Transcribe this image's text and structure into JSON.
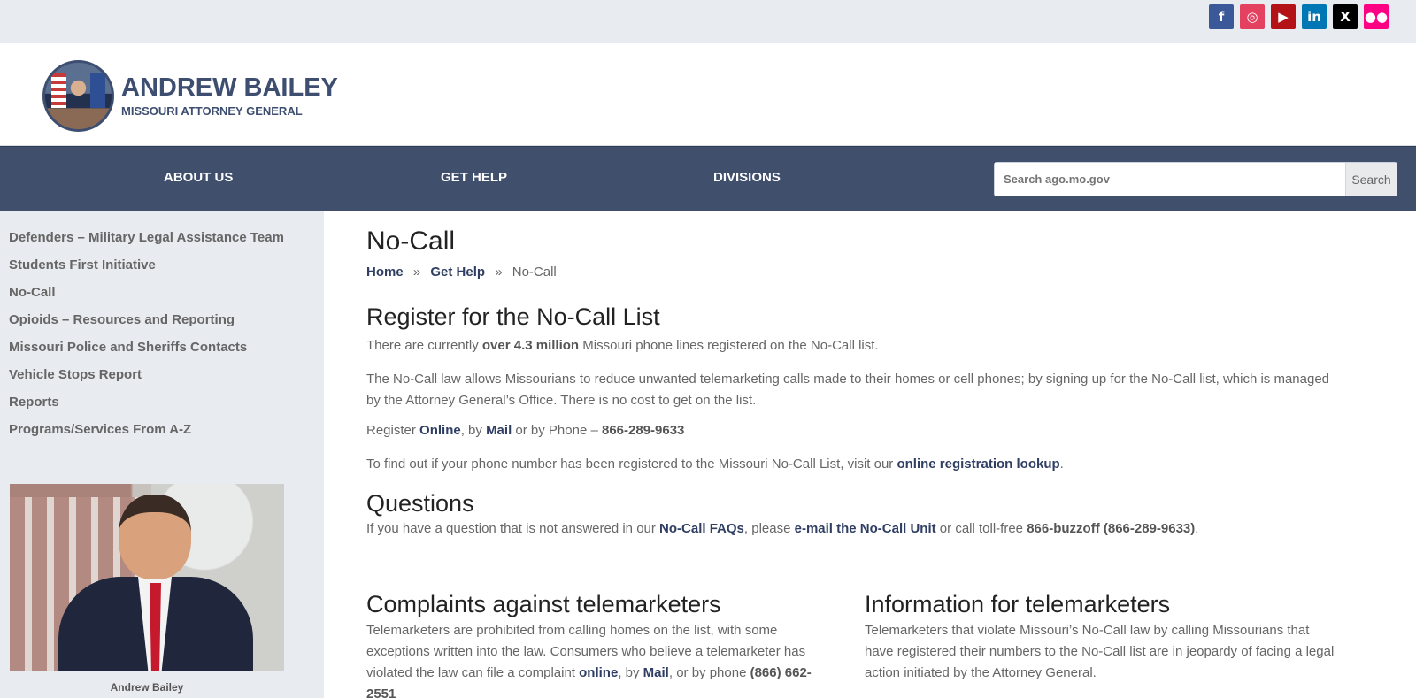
{
  "social": {
    "items": [
      {
        "label": "f",
        "color": "#3b5998"
      },
      {
        "label": "◎",
        "color": "#e4405f"
      },
      {
        "label": "▶",
        "color": "#b31217"
      },
      {
        "label": "in",
        "color": "#0077b5"
      },
      {
        "label": "X",
        "color": "#000000"
      },
      {
        "label": "●●",
        "color": "#ff0084"
      }
    ]
  },
  "brand": {
    "name": "ANDREW BAILEY",
    "subtitle": "MISSOURI ATTORNEY GENERAL"
  },
  "nav": {
    "about": "ABOUT US",
    "help": "GET HELP",
    "divisions": "DIVISIONS"
  },
  "search": {
    "placeholder": "Search ago.mo.gov",
    "button": "Search"
  },
  "sidebar": {
    "items": [
      "Defenders – Military Legal Assistance Team",
      "Students First Initiative",
      "No-Call",
      "Opioids – Resources and Reporting",
      "Missouri Police and Sheriffs Contacts",
      "Vehicle Stops Report",
      "Reports",
      "Programs/Services From A-Z"
    ],
    "photo_caption": "Andrew Bailey"
  },
  "page": {
    "title": "No-Call",
    "breadcrumb": {
      "home": "Home",
      "get_help": "Get Help",
      "current": "No-Call",
      "separator": "»"
    },
    "register": {
      "heading": "Register for the No-Call List",
      "line1_pre": "There are currently ",
      "line1_bold": "over 4.3 million",
      "line1_post": " Missouri phone lines registered on the No-Call list.",
      "para2": "The No-Call law allows Missourians to reduce unwanted telemarketing calls made to their homes or cell phones; by signing up for the No-Call list, which is managed by the Attorney General’s Office. There is no cost to get on the list.",
      "register_pre": "Register ",
      "online": "Online",
      "by": ", by ",
      "mail": "Mail",
      "phone_pre": " or by Phone – ",
      "phone": "866-289-9633",
      "lookup_pre": "To find out if your phone number has been registered to the Missouri No-Call List, visit our ",
      "lookup_link": "online registration lookup",
      "lookup_post": "."
    },
    "questions": {
      "heading": "Questions",
      "pre": "If you have a question that is not answered in our ",
      "faq": "No-Call FAQs",
      "mid": ", please ",
      "email": "e-mail the No-Call Unit",
      "post": " or call toll-free ",
      "phone": "866-buzzoff (866-289-9633)",
      "end": "."
    },
    "complaints": {
      "heading": "Complaints against telemarketers",
      "text_pre": "Telemarketers are prohibited from calling homes on the list, with some exceptions written into the law. Consumers who believe a telemarketer has violated the law can file a complaint ",
      "online": "online",
      "by": ", by ",
      "mail": "Mail",
      "phone_pre": ", or by phone ",
      "phone": "(866) 662-2551"
    },
    "information": {
      "heading": "Information for telemarketers",
      "text": "Telemarketers that violate Missouri’s No-Call law by calling Missourians that have registered their numbers to the No-Call list are in jeopardy of facing a legal action initiated by the Attorney General."
    }
  }
}
